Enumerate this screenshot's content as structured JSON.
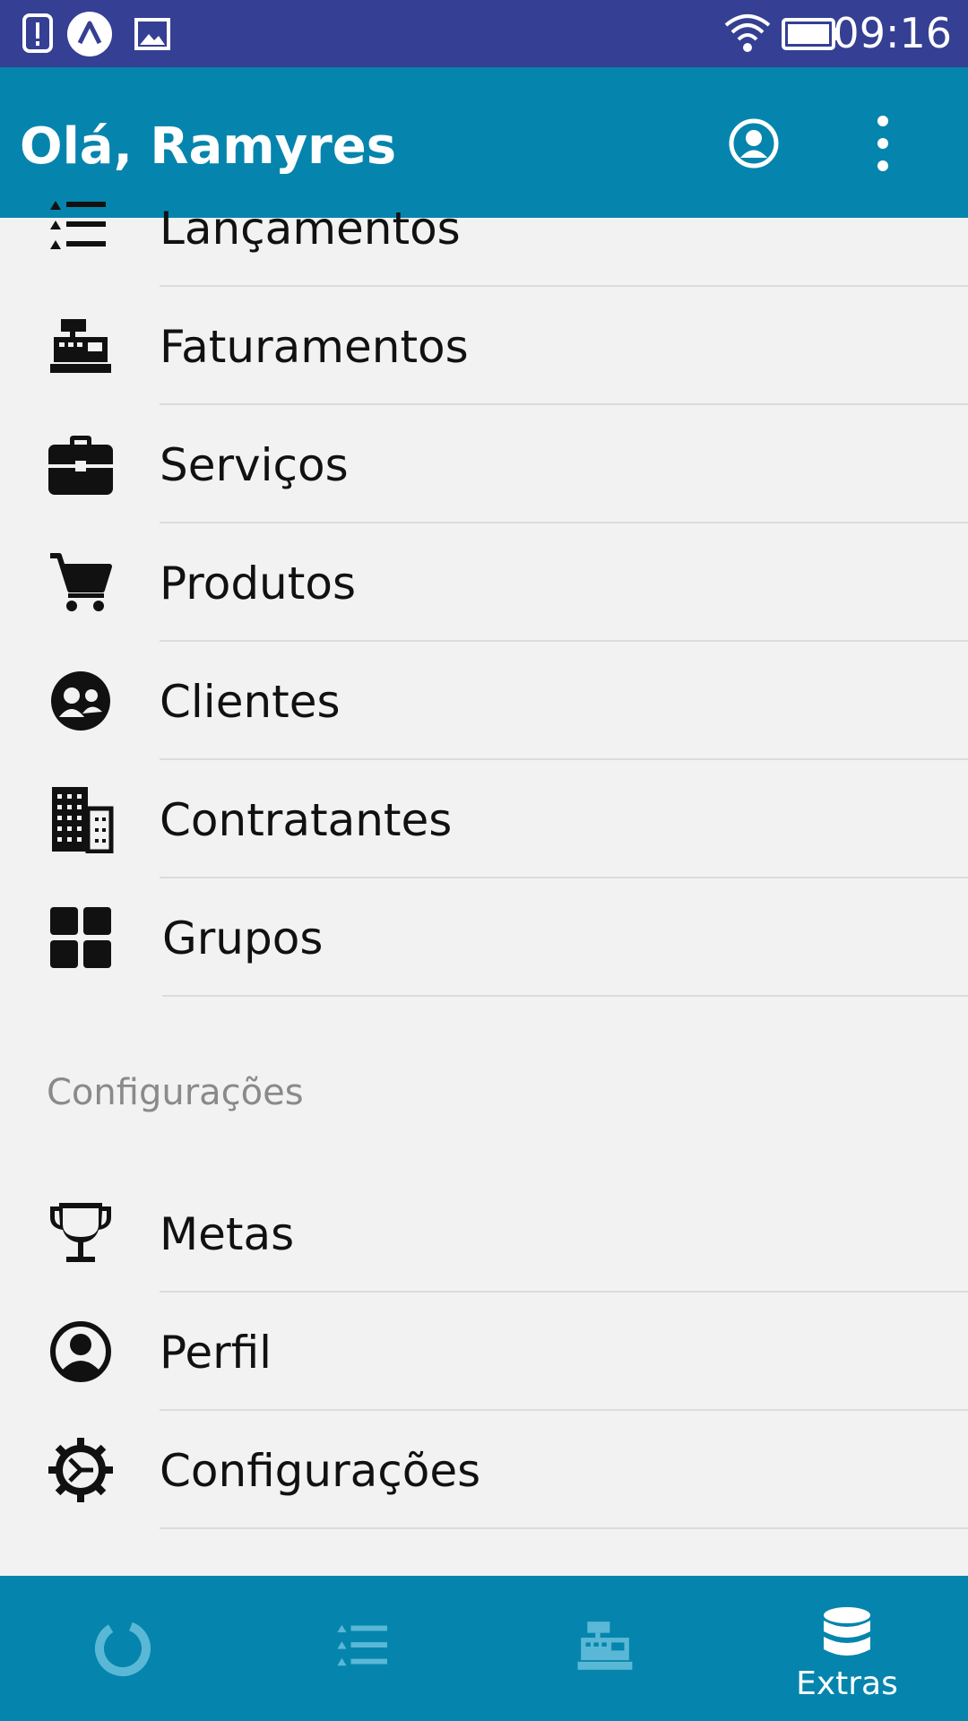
{
  "status_bar": {
    "time": "09:16",
    "icons": [
      "alert-icon",
      "app-a-icon",
      "image-icon",
      "wifi-icon",
      "battery-icon"
    ]
  },
  "app_bar": {
    "title": "Olá, Ramyres",
    "actions": [
      "account-icon",
      "more-vert-icon"
    ]
  },
  "menu": {
    "items": [
      {
        "label": "Lançamentos",
        "icon": "list-icon"
      },
      {
        "label": "Faturamentos",
        "icon": "cash-register-icon"
      },
      {
        "label": "Serviços",
        "icon": "briefcase-icon"
      },
      {
        "label": "Produtos",
        "icon": "cart-icon"
      },
      {
        "label": "Clientes",
        "icon": "clients-icon"
      },
      {
        "label": "Contratantes",
        "icon": "building-icon"
      },
      {
        "label": "Grupos",
        "icon": "grid-icon"
      }
    ],
    "section_header": "Configurações",
    "settings_items": [
      {
        "label": "Metas",
        "icon": "trophy-icon"
      },
      {
        "label": "Perfil",
        "icon": "account-icon"
      },
      {
        "label": "Configurações",
        "icon": "gear-icon"
      }
    ]
  },
  "bottom_nav": {
    "items": [
      {
        "label": "",
        "icon": "dashboard-ring-icon"
      },
      {
        "label": "",
        "icon": "list-icon"
      },
      {
        "label": "",
        "icon": "cash-register-icon"
      },
      {
        "label": "Extras",
        "icon": "database-icon",
        "active": true
      }
    ]
  },
  "colors": {
    "status_bar": "#353f93",
    "primary": "#0585ad",
    "background": "#f2f2f2",
    "inactive_nav_icon": "#5ab8d6"
  }
}
